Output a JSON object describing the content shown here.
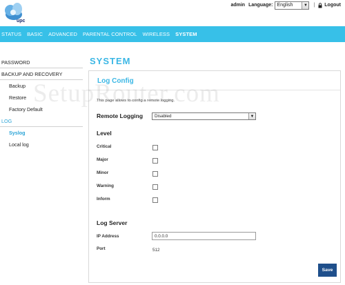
{
  "header": {
    "logo_text": "upc",
    "user": "admin",
    "language_label": "Language:",
    "language_value": "English",
    "separator": "|",
    "logout_label": "Logout"
  },
  "nav": {
    "items": [
      {
        "label": "STATUS"
      },
      {
        "label": "BASIC"
      },
      {
        "label": "ADVANCED"
      },
      {
        "label": "PARENTAL CONTROL"
      },
      {
        "label": "WIRELESS"
      },
      {
        "label": "SYSTEM",
        "active": true
      }
    ]
  },
  "sidebar": {
    "items": [
      {
        "label": "PASSWORD"
      },
      {
        "label": "BACKUP AND RECOVERY"
      },
      {
        "label": "Backup"
      },
      {
        "label": "Restore"
      },
      {
        "label": "Factory Default"
      },
      {
        "label": "LOG"
      },
      {
        "label": "Syslog"
      },
      {
        "label": "Local log"
      }
    ]
  },
  "main": {
    "page_title": "SYSTEM",
    "panel_title": "Log Config",
    "description": "This page allows to config a remote logging.",
    "remote_logging_label": "Remote Logging",
    "remote_logging_value": "Disabled",
    "level_heading": "Level",
    "levels": [
      {
        "label": "Critical",
        "checked": false
      },
      {
        "label": "Major",
        "checked": false
      },
      {
        "label": "Minor",
        "checked": false
      },
      {
        "label": "Warning",
        "checked": false
      },
      {
        "label": "Inform",
        "checked": false
      }
    ],
    "log_server_heading": "Log Server",
    "ip_address_label": "IP Address",
    "ip_address_value": "0.0.0.0",
    "port_label": "Port",
    "port_value": "512",
    "save_label": "Save"
  },
  "watermark": "SetupRouter.com",
  "colors": {
    "nav_bg": "#37c0e8",
    "title_blue": "#3bb7e5",
    "save_button": "#1f4f8b"
  }
}
